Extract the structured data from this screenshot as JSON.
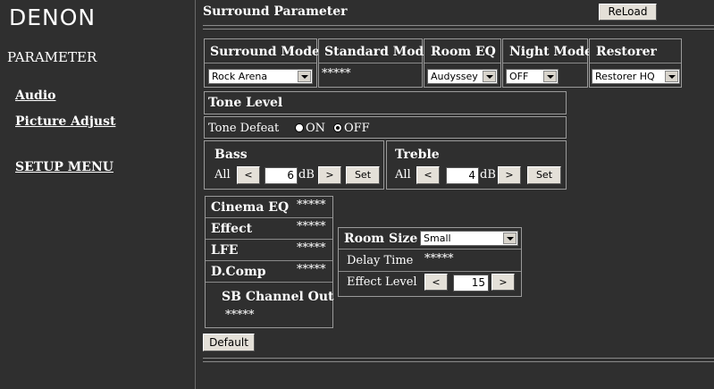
{
  "sidebar": {
    "logo": "DENON",
    "title": "PARAMETER",
    "links": [
      "Audio",
      "Picture Adjust",
      "SETUP MENU"
    ]
  },
  "header": {
    "title": "Surround Parameter",
    "reload_label": "ReLoad"
  },
  "mode_table": {
    "headers": [
      "Surround Mode",
      "Standard Mode",
      "Room EQ",
      "Night Mode",
      "Restorer"
    ],
    "surround_mode": "Rock Arena",
    "standard_mode": "*****",
    "room_eq": "Audyssey",
    "night_mode": "OFF",
    "restorer": "Restorer HQ"
  },
  "tone": {
    "title": "Tone Level",
    "defeat_label": "Tone Defeat",
    "on_label": "ON",
    "off_label": "OFF",
    "selected": "OFF",
    "bass": {
      "title": "Bass",
      "all_label": "All",
      "dec": "<",
      "value": "6",
      "unit": "dB",
      "inc": ">",
      "set": "Set"
    },
    "treble": {
      "title": "Treble",
      "all_label": "All",
      "dec": "<",
      "value": "4",
      "unit": "dB",
      "inc": ">",
      "set": "Set"
    }
  },
  "params": {
    "rows": [
      {
        "label": "Cinema EQ",
        "value": "*****"
      },
      {
        "label": "Effect",
        "value": "*****"
      },
      {
        "label": "LFE",
        "value": "*****"
      },
      {
        "label": "D.Comp",
        "value": "*****"
      }
    ],
    "sb_label": "SB Channel Out",
    "sb_value": "*****"
  },
  "room": {
    "size_label": "Room Size",
    "size_value": "Small",
    "delay_label": "Delay Time",
    "delay_value": "*****",
    "effect_label": "Effect Level",
    "effect_dec": "<",
    "effect_value": "15",
    "effect_inc": ">"
  },
  "default_label": "Default"
}
